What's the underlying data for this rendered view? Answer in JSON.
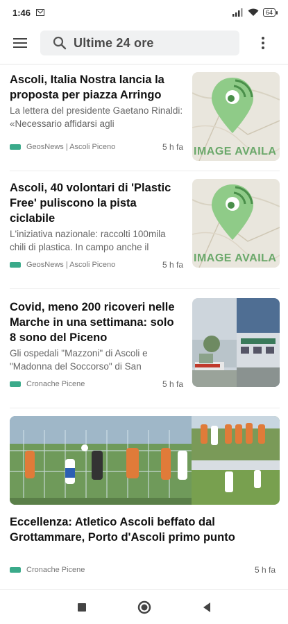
{
  "status": {
    "time": "1:46",
    "battery": "64"
  },
  "search": {
    "text": "Ultime 24 ore"
  },
  "articles": [
    {
      "title": "Ascoli, Italia Nostra lancia la proposta per piazza Arringo",
      "snippet": "La lettera del presidente Gaetano Rinaldi: «Necessario affidarsi agli",
      "source": "GeosNews | Ascoli Piceno",
      "time": "5 h fa",
      "image_text": "IMAGE AVAILA"
    },
    {
      "title": "Ascoli, 40 volontari di 'Plastic Free' puliscono la pista ciclabile",
      "snippet": "L'iniziativa nazionale: raccolti 100mila chili di plastica. In campo anche il",
      "source": "GeosNews | Ascoli Piceno",
      "time": "5 h fa",
      "image_text": "IMAGE AVAILA"
    },
    {
      "title": "Covid, meno 200 ricoveri  nelle Marche in una settimana:  solo 8 sono del Piceno",
      "snippet": "Gli ospedali \"Mazzoni\" di Ascoli e \"Madonna del Soccorso\" di San",
      "source": "Cronache Picene",
      "time": "5 h fa"
    },
    {
      "title": "Eccellenza: Atletico Ascoli  beffato dal Grottammare,  Porto d'Ascoli primo punto",
      "source": "Cronache Picene",
      "time": "5 h fa"
    }
  ],
  "colors": {
    "accent": "#3aaa8a",
    "map_pin": "#8fcb88"
  }
}
